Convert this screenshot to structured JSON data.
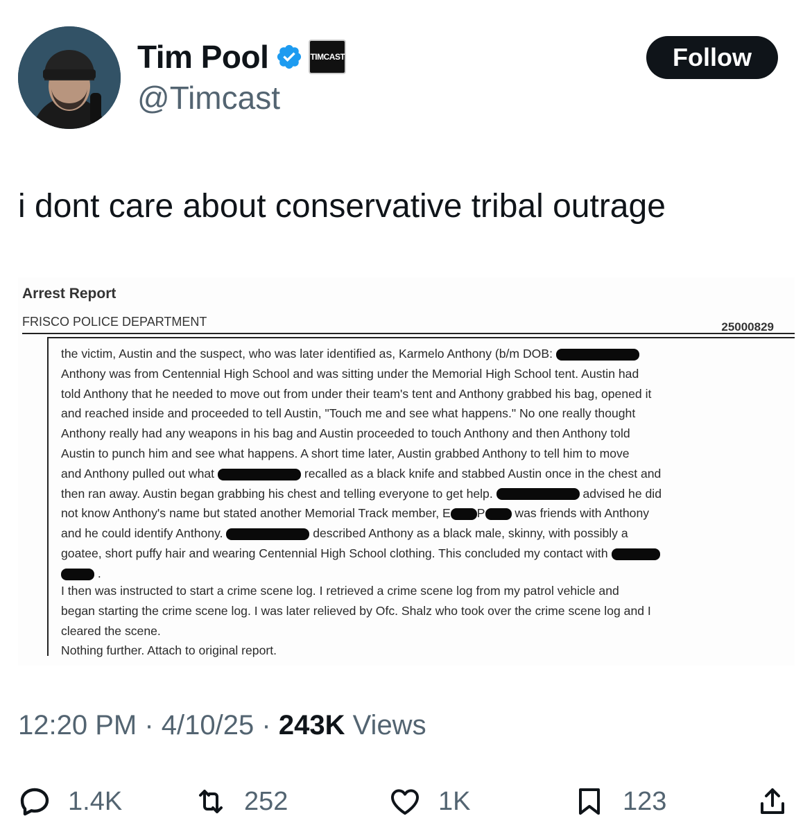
{
  "author": {
    "display_name": "Tim Pool",
    "handle": "@Timcast",
    "affiliate_badge": "TIMCAST",
    "verified_icon": "verified-badge-icon",
    "verified_color": "#1d9bf0"
  },
  "follow_label": "Follow",
  "tweet_text": "i dont care about conservative tribal outrage",
  "document": {
    "title": "Arrest Report",
    "department": "FRISCO POLICE DEPARTMENT",
    "report_number": "25000829",
    "paragraph1": [
      "the victim, Austin and the suspect, who was later identified as, Karmelo Anthony (b/m DOB:",
      "Anthony was from Centennial High School and was sitting under the Memorial High School tent. Austin had",
      "told Anthony that he needed to move out from under their team's tent and Anthony grabbed his bag, opened it",
      "and reached inside and proceeded to tell Austin, \"Touch me and see what happens.\" No one really thought",
      "Anthony really had any weapons in his bag and Austin proceeded to touch Anthony and then Anthony told",
      "Austin to punch him and see what happens. A short time later, Austin grabbed Anthony to tell him to move",
      [
        "and Anthony pulled out what",
        "recalled as a black knife and stabbed Austin once in the chest and"
      ],
      [
        "then ran away. Austin began grabbing his chest and telling everyone to get help.",
        "advised he did"
      ],
      [
        "not know Anthony's name but stated another Memorial Track member, E",
        "P",
        "was friends with Anthony"
      ],
      [
        "and he could identify Anthony.",
        "described Anthony as a black male, skinny, with possibly a"
      ],
      "goatee, short puffy hair and wearing Centennial High School clothing. This concluded my contact with",
      "."
    ],
    "paragraph2": [
      "I then was instructed to start a crime scene log. I retrieved a crime scene log from my patrol vehicle and",
      "began starting the crime scene log. I was later relieved by Ofc. Shalz who took over the crime scene log and I",
      "cleared the scene.",
      "Nothing further. Attach to original report."
    ]
  },
  "meta": {
    "time": "12:20 PM",
    "separator": "·",
    "date": "4/10/25",
    "views_count": "243K",
    "views_label": "Views"
  },
  "actions": [
    {
      "icon": "reply-icon",
      "count": "1.4K"
    },
    {
      "icon": "retweet-icon",
      "count": "252"
    },
    {
      "icon": "like-icon",
      "count": "1K"
    },
    {
      "icon": "bookmark-icon",
      "count": "123"
    },
    {
      "icon": "share-icon",
      "count": ""
    }
  ]
}
